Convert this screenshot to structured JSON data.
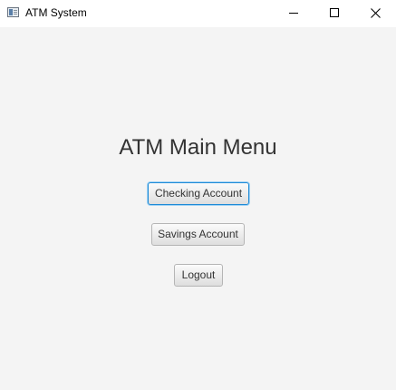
{
  "window": {
    "title": "ATM System",
    "icon": "app-window-icon",
    "controls": {
      "minimize_icon": "minimize-icon",
      "maximize_icon": "maximize-icon",
      "close_icon": "close-icon"
    }
  },
  "main": {
    "title": "ATM Main Menu",
    "buttons": {
      "checking": "Checking Account",
      "savings": "Savings Account",
      "logout": "Logout"
    },
    "focused_button": "checking"
  },
  "colors": {
    "background": "#f4f4f4",
    "titlebar": "#ffffff",
    "focus_ring": "#1e8ad6",
    "title_text": "#333333"
  }
}
